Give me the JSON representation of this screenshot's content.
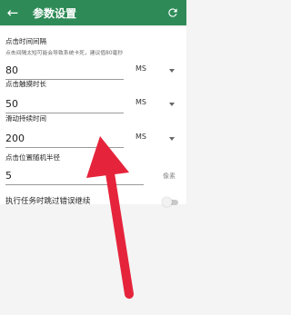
{
  "appbar": {
    "title": "参数设置",
    "back_icon": "left-arrow-icon",
    "refresh_icon": "refresh-icon",
    "color": "#2e8b57"
  },
  "fields": [
    {
      "label": "点击时间间隔",
      "note": "点击间隔太短可能会导致系统卡死，建议值80毫秒",
      "value": "80",
      "unit": "MS"
    },
    {
      "label": "点击触摸时长",
      "value": "50",
      "unit": "MS"
    },
    {
      "label": "滑动持续时间",
      "value": "200",
      "unit": "MS"
    },
    {
      "label": "点击位置随机半径",
      "value": "5",
      "unit": "像素"
    }
  ],
  "switch": {
    "label": "执行任务时跳过错误继续",
    "checked": false
  },
  "annotation": {
    "color": "#e5243b"
  }
}
